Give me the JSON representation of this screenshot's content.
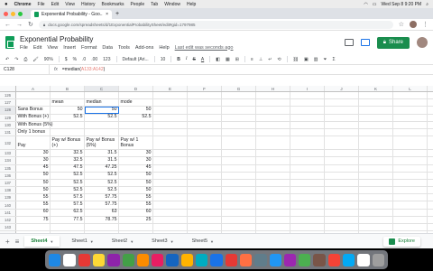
{
  "os_menubar": {
    "apple": "",
    "app": "Chrome",
    "items": [
      "File",
      "Edit",
      "View",
      "History",
      "Bookmarks",
      "People",
      "Tab",
      "Window",
      "Help"
    ],
    "clock": "Wed Sep 8 9:20 PM"
  },
  "browser": {
    "tab_title": "Exponential Probability - Goo...",
    "close": "×",
    "new_tab": "+",
    "url": "docs.google.com/spreadsheets/d/1ExponentialProbabilitySheet/edit#gid=1797985"
  },
  "doc": {
    "title": "Exponential Probability",
    "menu": [
      "File",
      "Edit",
      "View",
      "Insert",
      "Format",
      "Data",
      "Tools",
      "Add-ons",
      "Help"
    ],
    "last_edit": "Last edit was seconds ago",
    "share_label": "Share"
  },
  "toolbar": {
    "zoom": "90%",
    "currency": "$",
    "percent": "%",
    "dec_less": ".0",
    "dec_more": ".00",
    "numfmt": "123",
    "font": "Default (Ari...",
    "size": "10",
    "bold": "B",
    "italic": "I",
    "strike": "S",
    "text_color": "A"
  },
  "formula_bar": {
    "name_box": "C128",
    "fx": "fx",
    "formula_prefix": "=median(",
    "formula_range": "A133:A142",
    "formula_suffix": ")"
  },
  "grid": {
    "columns": [
      "A",
      "B",
      "C",
      "D",
      "E",
      "F",
      "G",
      "H",
      "I",
      "J",
      "K",
      "L"
    ],
    "active_column": "C",
    "rows": [
      {
        "n": "126",
        "cells": [
          "",
          "",
          "",
          "",
          ""
        ]
      },
      {
        "n": "127",
        "cells": [
          "",
          "mean",
          "median",
          "mode",
          ""
        ]
      },
      {
        "n": "128",
        "cells": [
          "Sans Bonus",
          "50",
          "50",
          "50",
          ""
        ]
      },
      {
        "n": "129",
        "cells": [
          "With Bonus (+)",
          "52.5",
          "52.5",
          "52.5",
          ""
        ]
      },
      {
        "n": "130",
        "cells": [
          "With Bonus (5%)",
          "",
          "",
          "",
          ""
        ]
      },
      {
        "n": "131",
        "cells": [
          "Only 1 bonus",
          "",
          "",
          "",
          ""
        ]
      },
      {
        "n": "132",
        "cells": [
          "Pay",
          "Pay w/ Bonus (+)",
          "Pay w/ Bonus (5%)",
          "Pay w/ 1 Bonus",
          ""
        ]
      },
      {
        "n": "133",
        "cells": [
          "30",
          "32.5",
          "31.5",
          "30",
          ""
        ]
      },
      {
        "n": "134",
        "cells": [
          "30",
          "32.5",
          "31.5",
          "30",
          ""
        ]
      },
      {
        "n": "135",
        "cells": [
          "45",
          "47.5",
          "47.25",
          "45",
          ""
        ]
      },
      {
        "n": "136",
        "cells": [
          "50",
          "52.5",
          "52.5",
          "50",
          ""
        ]
      },
      {
        "n": "137",
        "cells": [
          "50",
          "52.5",
          "52.5",
          "50",
          ""
        ]
      },
      {
        "n": "138",
        "cells": [
          "50",
          "52.5",
          "52.5",
          "50",
          ""
        ]
      },
      {
        "n": "139",
        "cells": [
          "55",
          "57.5",
          "57.75",
          "55",
          ""
        ]
      },
      {
        "n": "140",
        "cells": [
          "55",
          "57.5",
          "57.75",
          "55",
          ""
        ]
      },
      {
        "n": "141",
        "cells": [
          "60",
          "62.5",
          "63",
          "60",
          ""
        ]
      },
      {
        "n": "142",
        "cells": [
          "75",
          "77.5",
          "78.75",
          "25",
          ""
        ]
      },
      {
        "n": "143",
        "cells": [
          "",
          "",
          "",
          "",
          ""
        ]
      },
      {
        "n": "144",
        "cells": [
          "",
          "",
          "",
          "",
          ""
        ]
      }
    ]
  },
  "sheet_tabs": {
    "add": "+",
    "list": "≡",
    "tabs": [
      "Sheet4",
      "Sheet1",
      "Sheet2",
      "Sheet3",
      "Sheet5"
    ],
    "active": "Sheet4",
    "explore": "Explore"
  },
  "dock": {
    "colors": [
      "#1e88e5",
      "#ffffff",
      "#e53935",
      "#fdd835",
      "#8e24aa",
      "#43a047",
      "#fb8c00",
      "#e91e63",
      "#1565c0",
      "#ffb300",
      "#00acc1",
      "#1a73e8",
      "#e53935",
      "#ff7043",
      "#607d8b",
      "#2196f3",
      "#9c27b0",
      "#4caf50",
      "#795548",
      "#f44336",
      "#03a9f4",
      "#ffffff",
      "#9e9e9e"
    ]
  }
}
